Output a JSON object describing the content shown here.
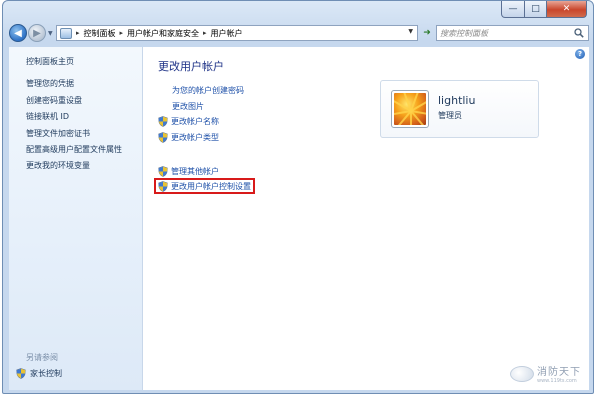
{
  "window": {
    "controls": {
      "minimize": "—",
      "maximize": "□",
      "close": "✕"
    }
  },
  "navigation": {
    "back_icon": "back-arrow-icon",
    "forward_icon": "forward-arrow-icon",
    "breadcrumbs": [
      "控制面板",
      "用户帐户和家庭安全",
      "用户帐户"
    ],
    "search_placeholder": "搜索控制面板"
  },
  "sidebar": {
    "home": "控制面板主页",
    "links": [
      "管理您的凭据",
      "创建密码重设盘",
      "链接联机 ID",
      "管理文件加密证书",
      "配置高级用户配置文件属性",
      "更改我的环境变量"
    ],
    "see_also": "另请参阅",
    "see_also_links": [
      "家长控制"
    ]
  },
  "main": {
    "title": "更改用户帐户",
    "tasks": [
      "为您的帐户创建密码",
      "更改图片"
    ],
    "shield_tasks": [
      "更改帐户名称",
      "更改帐户类型"
    ],
    "other_tasks": [
      "管理其他帐户",
      "更改用户帐户控制设置"
    ],
    "highlighted_task": "更改用户帐户控制设置"
  },
  "user": {
    "name": "lightliu",
    "role": "管理员",
    "avatar_icon": "flower-avatar-icon"
  },
  "watermark": {
    "brand": "消防天下",
    "url": "www.119ts.com"
  },
  "colors": {
    "link": "#1e50a8",
    "title": "#1e3287",
    "highlight_border": "#d81a1a",
    "close_button": "#c9462c"
  }
}
